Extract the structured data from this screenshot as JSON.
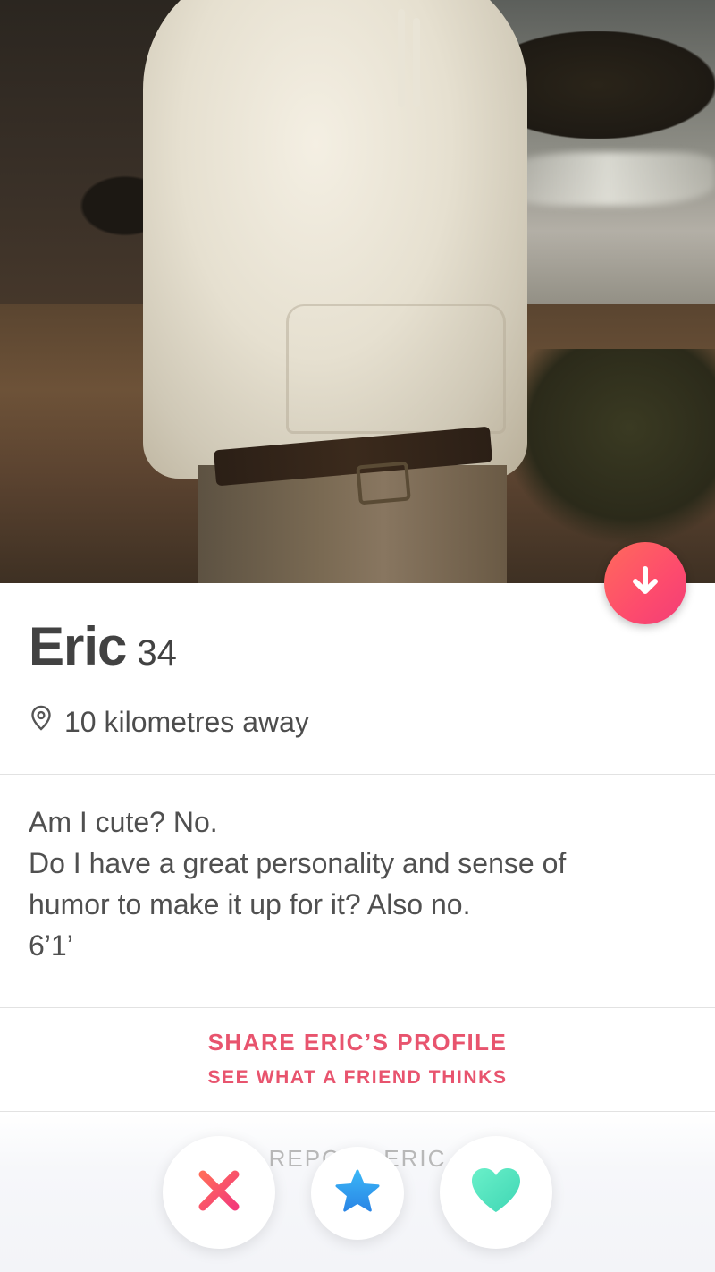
{
  "profile": {
    "name": "Eric",
    "age": "34",
    "distance": "10 kilometres away",
    "bio_lines": [
      "Am I cute? No.",
      "Do I have a great personality and sense of",
      "humor to make it up for it? Also no.",
      "6’1’"
    ]
  },
  "share": {
    "title": "SHARE ERIC’S PROFILE",
    "subtitle": "SEE WHAT A FRIEND THINKS"
  },
  "report": {
    "label": "REPORT ERIC"
  },
  "actions": {
    "nope_icon": "x-icon",
    "super_like_icon": "star-icon",
    "like_icon": "heart-icon",
    "collapse_icon": "arrow-down-icon"
  },
  "colors": {
    "accent": "#fd4b6d",
    "share_text": "#e8546e",
    "super_like": "#2d9af0",
    "like": "#4fe3c0"
  }
}
